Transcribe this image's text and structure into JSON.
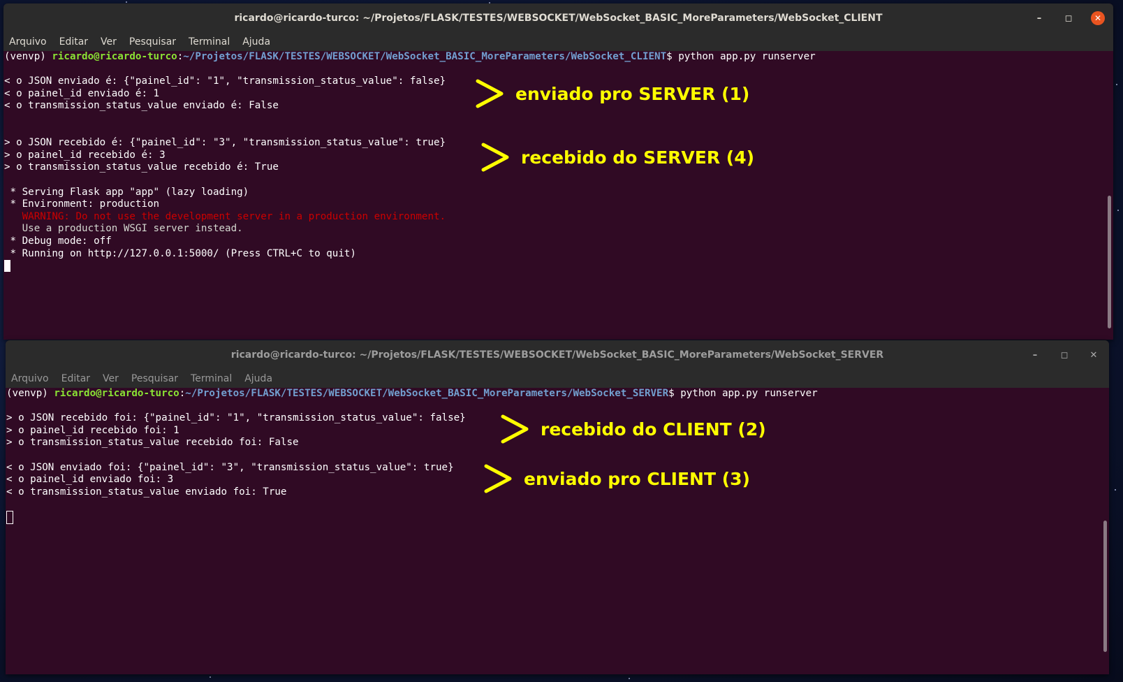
{
  "client_window": {
    "title": "ricardo@ricardo-turco: ~/Projetos/FLASK/TESTES/WEBSOCKET/WebSocket_BASIC_MoreParameters/WebSocket_CLIENT",
    "menu": [
      "Arquivo",
      "Editar",
      "Ver",
      "Pesquisar",
      "Terminal",
      "Ajuda"
    ],
    "prompt": {
      "venv": "(venvp) ",
      "user": "ricardo@ricardo-turco",
      "colon": ":",
      "path": "~/Projetos/FLASK/TESTES/WEBSOCKET/WebSocket_BASIC_MoreParameters/WebSocket_CLIENT",
      "command": "$ python app.py runserver"
    },
    "lines_sent": [
      "< o JSON enviado é: {\"painel_id\": \"1\", \"transmission_status_value\": false}",
      "< o painel_id enviado é: 1",
      "< o transmission_status_value enviado é: False"
    ],
    "lines_received": [
      "> o JSON recebido é: {\"painel_id\": \"3\", \"transmission_status_value\": true}",
      "> o painel_id recebido é: 3",
      "> o transmission_status_value recebido é: True"
    ],
    "flask": {
      "serving": " * Serving Flask app \"app\" (lazy loading)",
      "environment": " * Environment: production",
      "warning": "   WARNING: Do not use the development server in a production environment.",
      "wsgi": "   Use a production WSGI server instead.",
      "debug": " * Debug mode: off",
      "running": " * Running on http://127.0.0.1:5000/ (Press CTRL+C to quit)"
    }
  },
  "server_window": {
    "title": "ricardo@ricardo-turco: ~/Projetos/FLASK/TESTES/WEBSOCKET/WebSocket_BASIC_MoreParameters/WebSocket_SERVER",
    "menu": [
      "Arquivo",
      "Editar",
      "Ver",
      "Pesquisar",
      "Terminal",
      "Ajuda"
    ],
    "prompt": {
      "venv": "(venvp) ",
      "user": "ricardo@ricardo-turco",
      "colon": ":",
      "path": "~/Projetos/FLASK/TESTES/WEBSOCKET/WebSocket_BASIC_MoreParameters/WebSocket_SERVER",
      "command": "$ python app.py runserver"
    },
    "lines_received": [
      "> o JSON recebido foi: {\"painel_id\": \"1\", \"transmission_status_value\": false}",
      "> o painel_id recebido foi: 1",
      "> o transmission_status_value recebido foi: False"
    ],
    "lines_sent": [
      "< o JSON enviado foi: {\"painel_id\": \"3\", \"transmission_status_value\": true}",
      "< o painel_id enviado foi: 3",
      "< o transmission_status_value enviado foi: True"
    ]
  },
  "annotations": {
    "a1": "enviado pro SERVER (1)",
    "a2": "recebido do CLIENT (2)",
    "a3": "enviado pro CLIENT (3)",
    "a4": "recebido do SERVER (4)"
  },
  "colors": {
    "terminal_bg": "#300a24",
    "titlebar_bg": "#2b2b2b",
    "prompt_user": "#8ae234",
    "prompt_path": "#729fcf",
    "warning": "#cc0000",
    "annotation": "#ffff00",
    "close_button": "#e95420"
  },
  "icons": [
    "minimize-icon",
    "maximize-icon",
    "close-icon"
  ]
}
